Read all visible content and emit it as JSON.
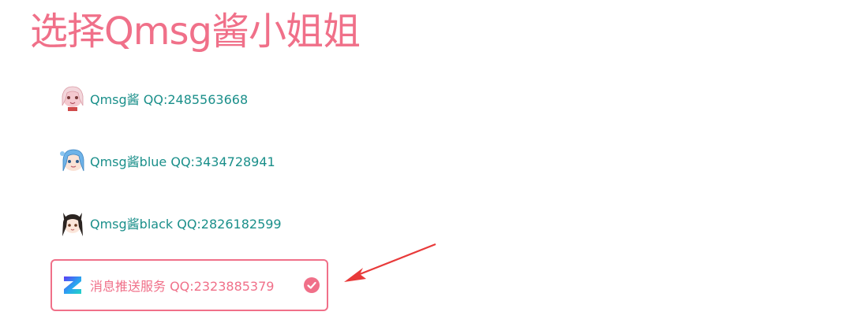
{
  "page": {
    "title": "选择Qmsg酱小姐姐"
  },
  "bots": [
    {
      "label": "Qmsg酱 QQ:2485563668",
      "avatar": "anime-girl-pink-avatar",
      "selected": false
    },
    {
      "label": "Qmsg酱blue QQ:3434728941",
      "avatar": "anime-girl-blue-avatar",
      "selected": false
    },
    {
      "label": "Qmsg酱black QQ:2826182599",
      "avatar": "anime-girl-black-avatar",
      "selected": false
    },
    {
      "label": "消息推送服务 QQ:2323885379",
      "avatar": "z-logo-icon",
      "selected": true
    }
  ],
  "colors": {
    "accent": "#f07089",
    "link": "#1a8f8a",
    "arrow": "#e83a3a"
  }
}
